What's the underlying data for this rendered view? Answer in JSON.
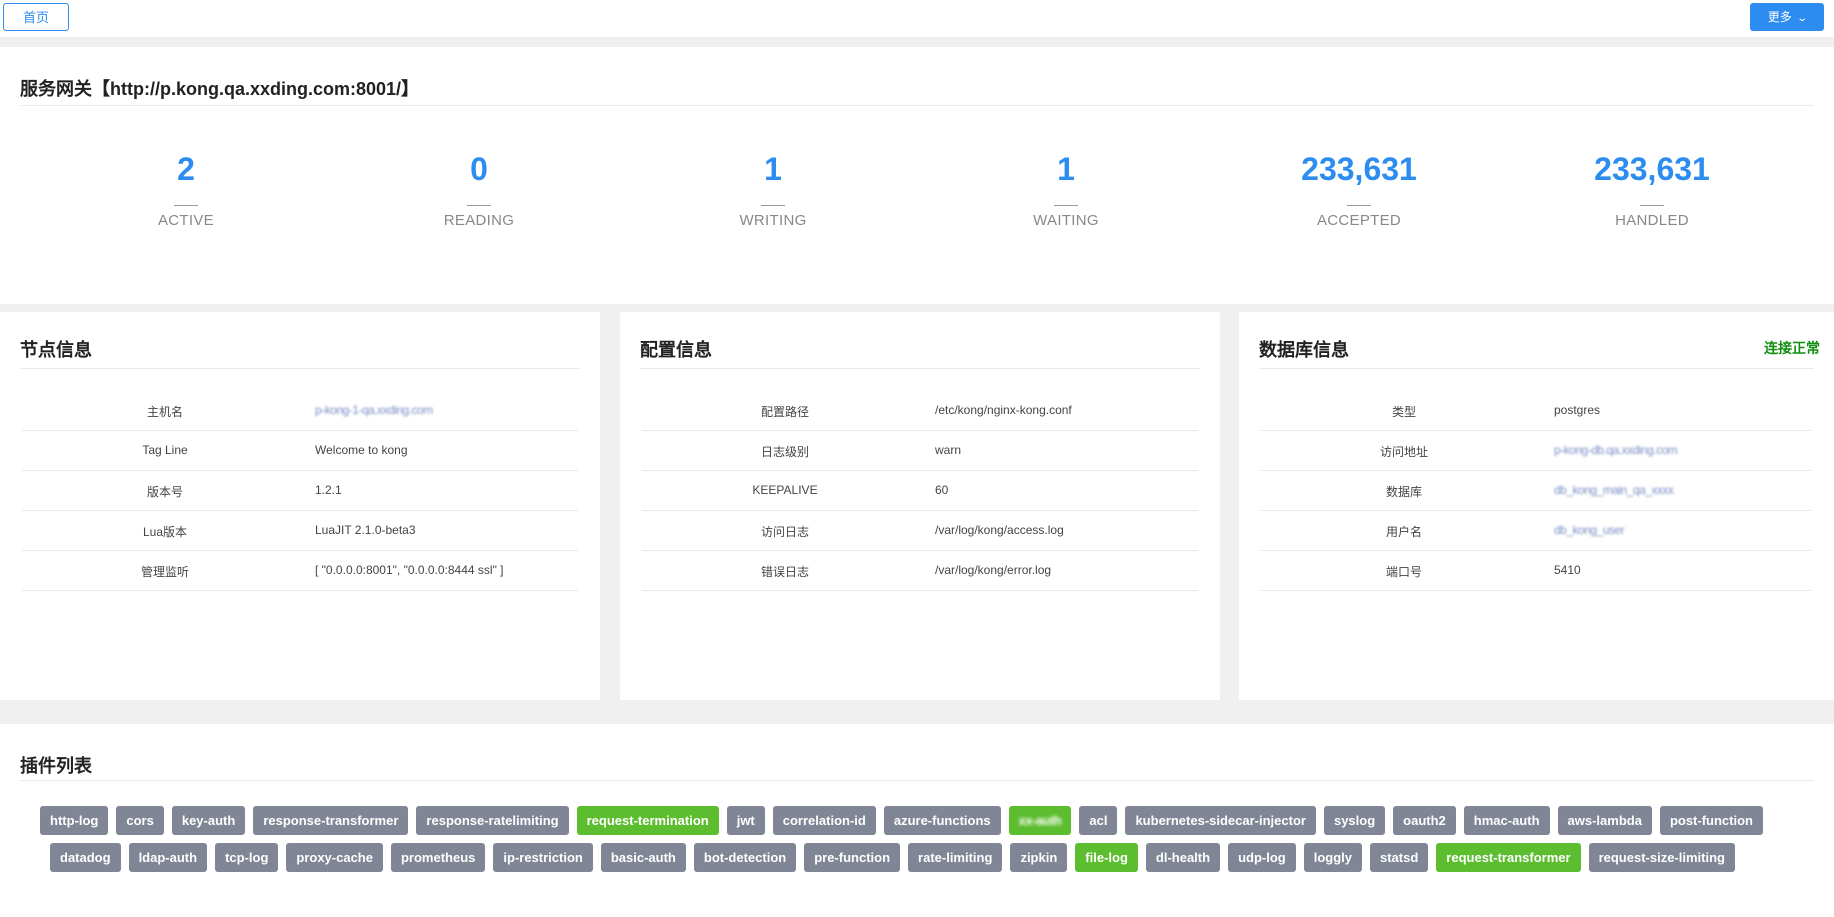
{
  "topbar": {
    "home_label": "首页",
    "more_label": "更多"
  },
  "gateway": {
    "title": "服务网关【http://p.kong.qa.xxding.com:8001/】",
    "stats": [
      {
        "value": "2",
        "label": "ACTIVE"
      },
      {
        "value": "0",
        "label": "READING"
      },
      {
        "value": "1",
        "label": "WRITING"
      },
      {
        "value": "1",
        "label": "WAITING"
      },
      {
        "value": "233,631",
        "label": "ACCEPTED"
      },
      {
        "value": "233,631",
        "label": "HANDLED"
      }
    ]
  },
  "node_info": {
    "title": "节点信息",
    "rows": [
      {
        "key": "主机名",
        "value": "p-kong-1-qa.xxding.com"
      },
      {
        "key": "Tag Line",
        "value": "Welcome to kong"
      },
      {
        "key": "版本号",
        "value": "1.2.1"
      },
      {
        "key": "Lua版本",
        "value": "LuaJIT 2.1.0-beta3"
      },
      {
        "key": "管理监听",
        "value": "[ \"0.0.0.0:8001\", \"0.0.0.0:8444 ssl\" ]"
      }
    ]
  },
  "config_info": {
    "title": "配置信息",
    "rows": [
      {
        "key": "配置路径",
        "value": "/etc/kong/nginx-kong.conf"
      },
      {
        "key": "日志级别",
        "value": "warn"
      },
      {
        "key": "KEEPALIVE",
        "value": "60"
      },
      {
        "key": "访问日志",
        "value": "/var/log/kong/access.log"
      },
      {
        "key": "错误日志",
        "value": "/var/log/kong/error.log"
      }
    ]
  },
  "db_info": {
    "title": "数据库信息",
    "status": "连接正常",
    "status_color": "#128f12",
    "rows": [
      {
        "key": "类型",
        "value": "postgres"
      },
      {
        "key": "访问地址",
        "value": "p-kong-db.qa.xxding.com"
      },
      {
        "key": "数据库",
        "value": "db_kong_main_qa_xxxx"
      },
      {
        "key": "用户名",
        "value": "db_kong_user"
      },
      {
        "key": "端口号",
        "value": "5410"
      }
    ]
  },
  "plugins": {
    "title": "插件列表",
    "row1": [
      {
        "name": "http-log",
        "enabled": false
      },
      {
        "name": "cors",
        "enabled": false
      },
      {
        "name": "key-auth",
        "enabled": false
      },
      {
        "name": "response-transformer",
        "enabled": false
      },
      {
        "name": "response-ratelimiting",
        "enabled": false
      },
      {
        "name": "request-termination",
        "enabled": true
      },
      {
        "name": "jwt",
        "enabled": false
      },
      {
        "name": "correlation-id",
        "enabled": false
      },
      {
        "name": "azure-functions",
        "enabled": false
      },
      {
        "name": "xx-auth",
        "enabled": true
      },
      {
        "name": "acl",
        "enabled": false
      },
      {
        "name": "kubernetes-sidecar-injector",
        "enabled": false
      },
      {
        "name": "syslog",
        "enabled": false
      },
      {
        "name": "oauth2",
        "enabled": false
      },
      {
        "name": "hmac-auth",
        "enabled": false
      },
      {
        "name": "aws-lambda",
        "enabled": false
      },
      {
        "name": "post-function",
        "enabled": false
      }
    ],
    "row2": [
      {
        "name": "datadog",
        "enabled": false
      },
      {
        "name": "ldap-auth",
        "enabled": false
      },
      {
        "name": "tcp-log",
        "enabled": false
      },
      {
        "name": "proxy-cache",
        "enabled": false
      },
      {
        "name": "prometheus",
        "enabled": false
      },
      {
        "name": "ip-restriction",
        "enabled": false
      },
      {
        "name": "basic-auth",
        "enabled": false
      },
      {
        "name": "bot-detection",
        "enabled": false
      },
      {
        "name": "pre-function",
        "enabled": false
      },
      {
        "name": "rate-limiting",
        "enabled": false
      },
      {
        "name": "zipkin",
        "enabled": false
      },
      {
        "name": "file-log",
        "enabled": true
      },
      {
        "name": "dl-health",
        "enabled": false
      },
      {
        "name": "udp-log",
        "enabled": false
      },
      {
        "name": "loggly",
        "enabled": false
      },
      {
        "name": "statsd",
        "enabled": false
      },
      {
        "name": "request-transformer",
        "enabled": true
      },
      {
        "name": "request-size-limiting",
        "enabled": false
      }
    ],
    "colors": {
      "enabled": "#5cbd2f",
      "disabled": "#808695"
    }
  }
}
